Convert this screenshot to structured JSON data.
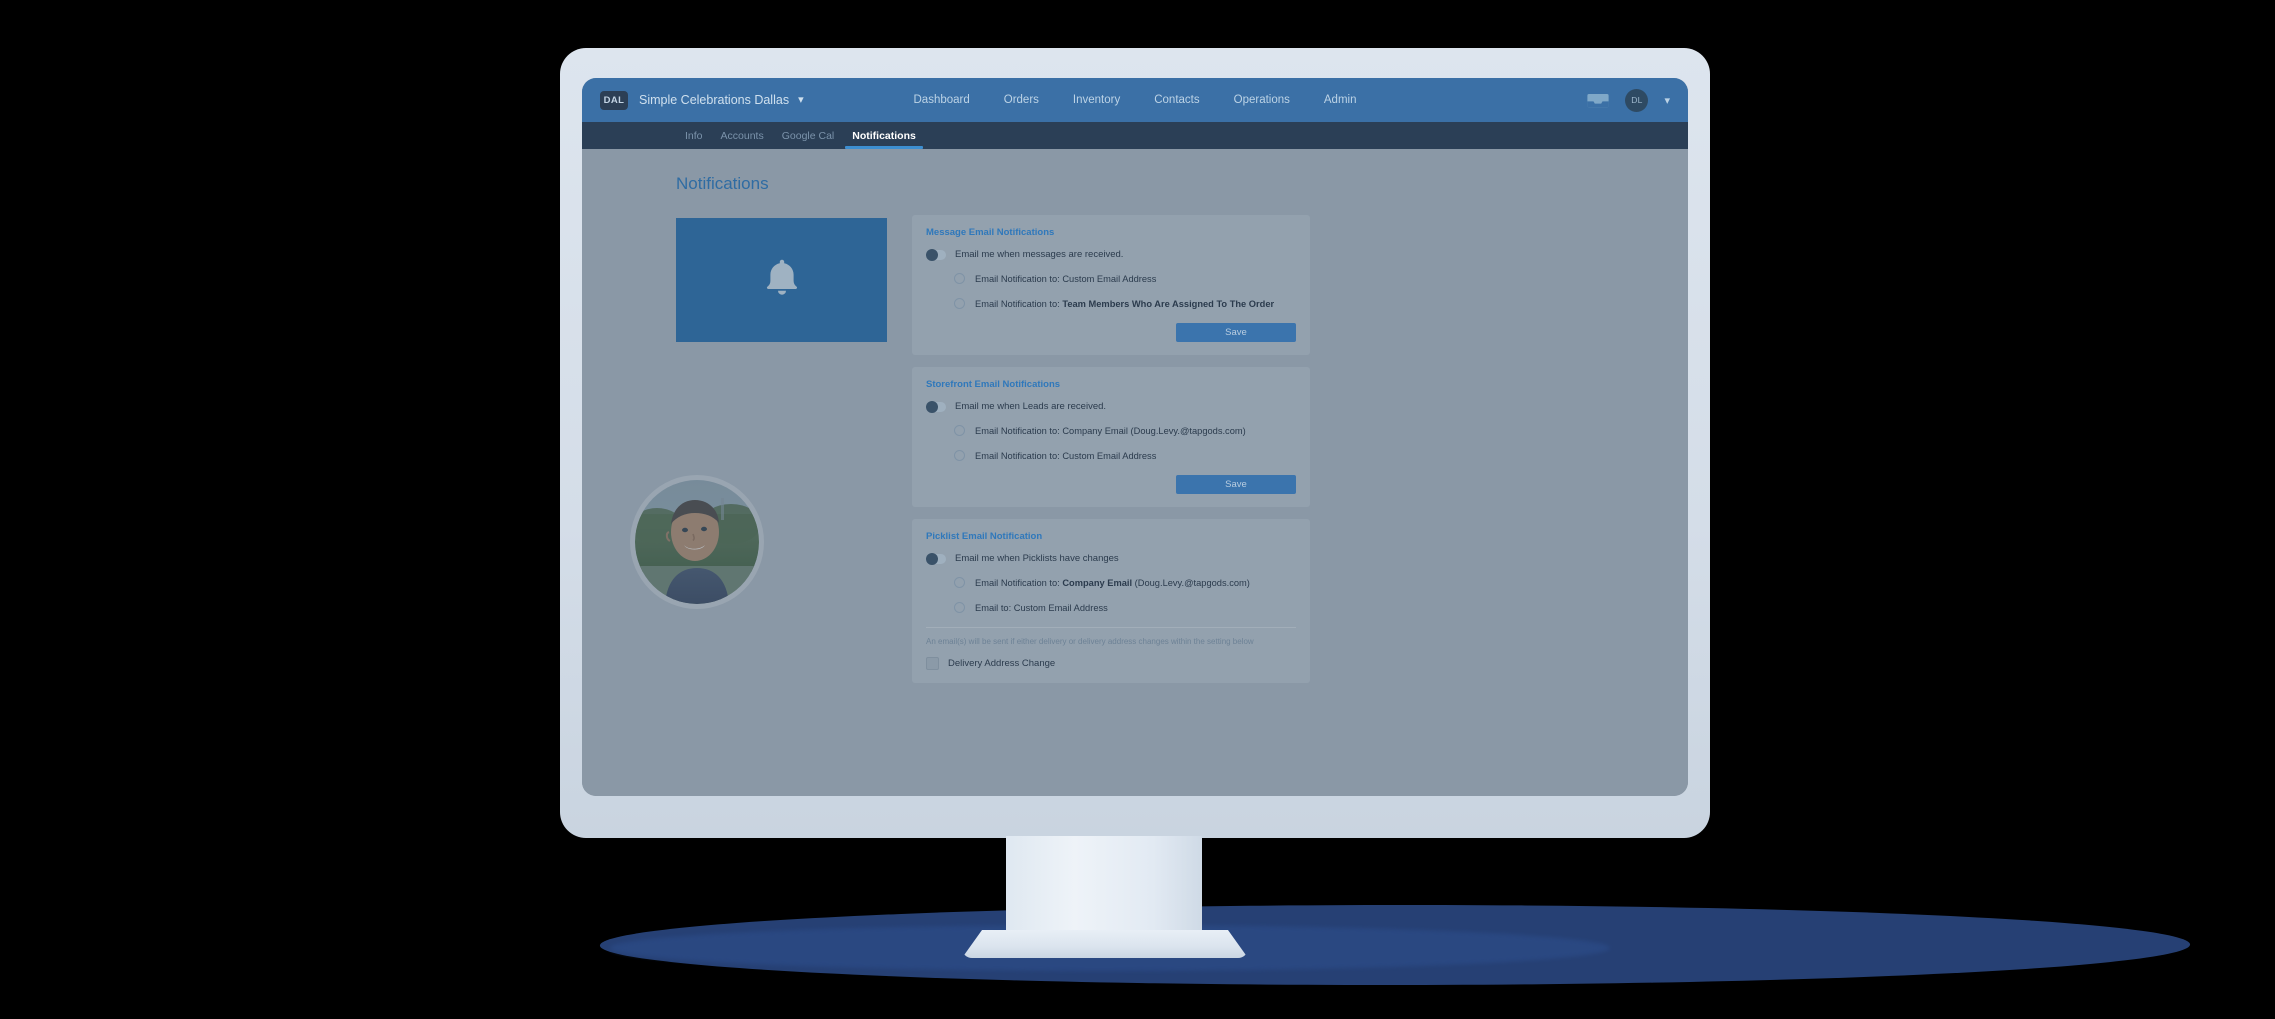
{
  "topnav": {
    "brand_badge": "DAL",
    "brand_name": "Simple Celebrations Dallas",
    "brand_caret": "▾",
    "items": [
      {
        "label": "Dashboard"
      },
      {
        "label": "Orders"
      },
      {
        "label": "Inventory"
      },
      {
        "label": "Contacts"
      },
      {
        "label": "Operations"
      },
      {
        "label": "Admin"
      }
    ],
    "inbox_icon": "inbox-tray-icon",
    "user_initials": "DL",
    "user_caret": "▾"
  },
  "subnav": {
    "tabs": [
      {
        "label": "Info",
        "active": false
      },
      {
        "label": "Accounts",
        "active": false
      },
      {
        "label": "Google Cal",
        "active": false
      },
      {
        "label": "Notifications",
        "active": true
      }
    ]
  },
  "page": {
    "title": "Notifications",
    "bell_icon": "bell-icon"
  },
  "cards": [
    {
      "title": "Message Email Notifications",
      "toggle_label": "Email me when messages are received.",
      "toggle_on": false,
      "options": [
        {
          "prefix": "Email Notification to: Custom Email Address",
          "strong": "",
          "suffix": ""
        },
        {
          "prefix": "Email Notification to: ",
          "strong": "Team Members Who Are Assigned To The Order",
          "suffix": ""
        }
      ],
      "save_label": "Save"
    },
    {
      "title": "Storefront Email Notifications",
      "toggle_label": "Email me when Leads are received.",
      "toggle_on": false,
      "options": [
        {
          "prefix": "Email Notification to: Company Email (Doug.Levy.@tapgods.com)",
          "strong": "",
          "suffix": ""
        },
        {
          "prefix": "Email Notification to: Custom Email Address",
          "strong": "",
          "suffix": ""
        }
      ],
      "save_label": "Save"
    },
    {
      "title": "Picklist Email Notification",
      "toggle_label": "Email me when Picklists have changes",
      "toggle_on": false,
      "options": [
        {
          "prefix": "Email Notification to: ",
          "strong": "Company Email",
          "suffix": " (Doug.Levy.@tapgods.com)"
        },
        {
          "prefix": "Email to: Custom Email Address",
          "strong": "",
          "suffix": ""
        }
      ],
      "hint": "An email(s) will be sent if either delivery or delivery address changes within the setting below",
      "checkbox_label": "Delivery Address Change",
      "checkbox_checked": false
    }
  ],
  "colors": {
    "topnav_blue": "#3b70a6",
    "subnav_navy": "#2b3f56",
    "page_gray": "#8a98a6",
    "card_gray": "#93a1ae",
    "accent_blue": "#2f78bb",
    "save_blue": "#3b74ad",
    "bell_panel": "#2e6596",
    "bezel": "#dde5ee",
    "shadow_navy": "#28437a"
  }
}
